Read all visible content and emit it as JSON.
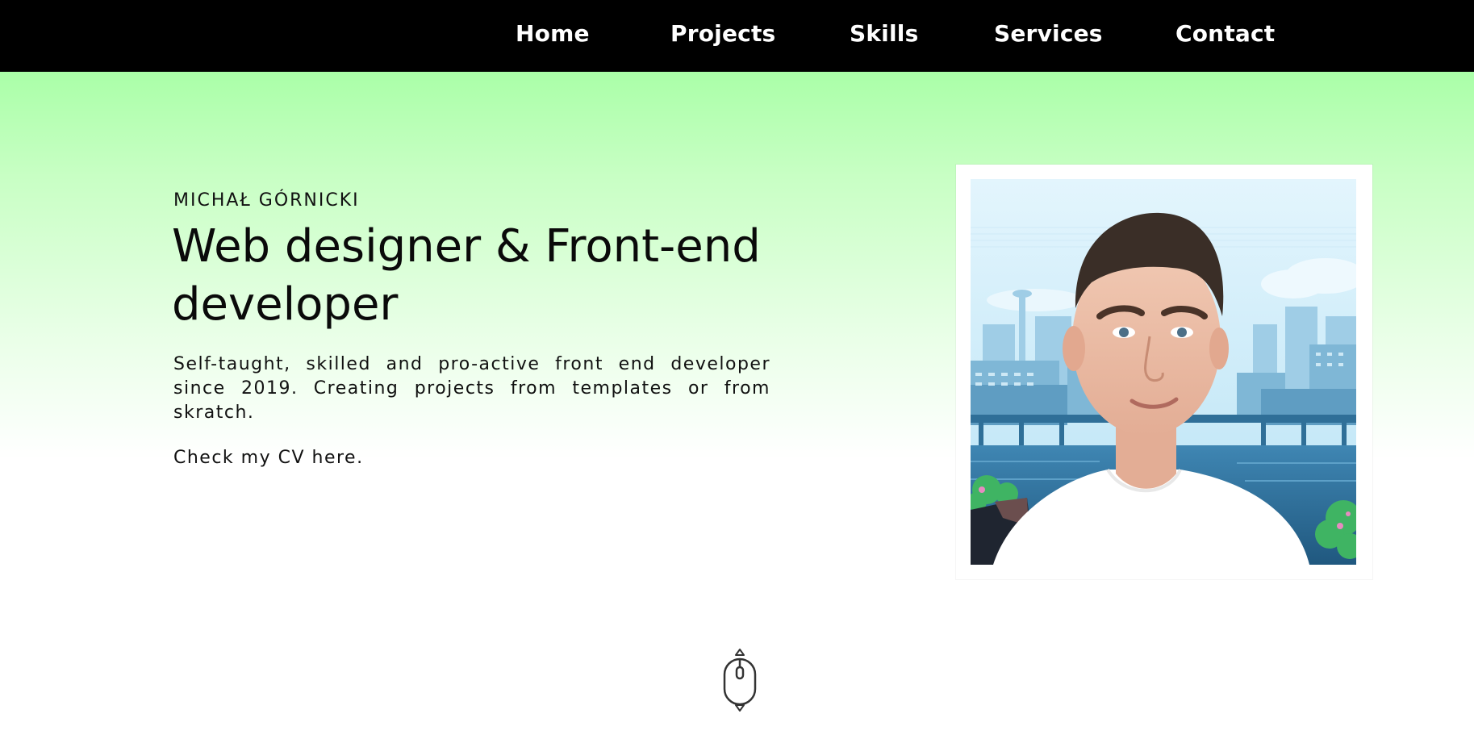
{
  "nav": {
    "items": [
      {
        "label": "Home"
      },
      {
        "label": "Projects"
      },
      {
        "label": "Skills"
      },
      {
        "label": "Services"
      },
      {
        "label": "Contact"
      }
    ]
  },
  "hero": {
    "eyebrow": "MICHAŁ GÓRNICKI",
    "headline": "Web designer & Front-end developer",
    "bio": "Self-taught, skilled and pro-active front end developer since 2019. Creating projects from templates or from skratch.",
    "cv_text": "Check my CV here."
  },
  "icons": {
    "scroll": "mouse-scroll-icon",
    "portrait": "profile-photo"
  },
  "colors": {
    "nav_bg": "#000000",
    "nav_text": "#ffffff",
    "hero_gradient_top": "#aaffa8",
    "hero_gradient_bottom": "#ffffff"
  }
}
